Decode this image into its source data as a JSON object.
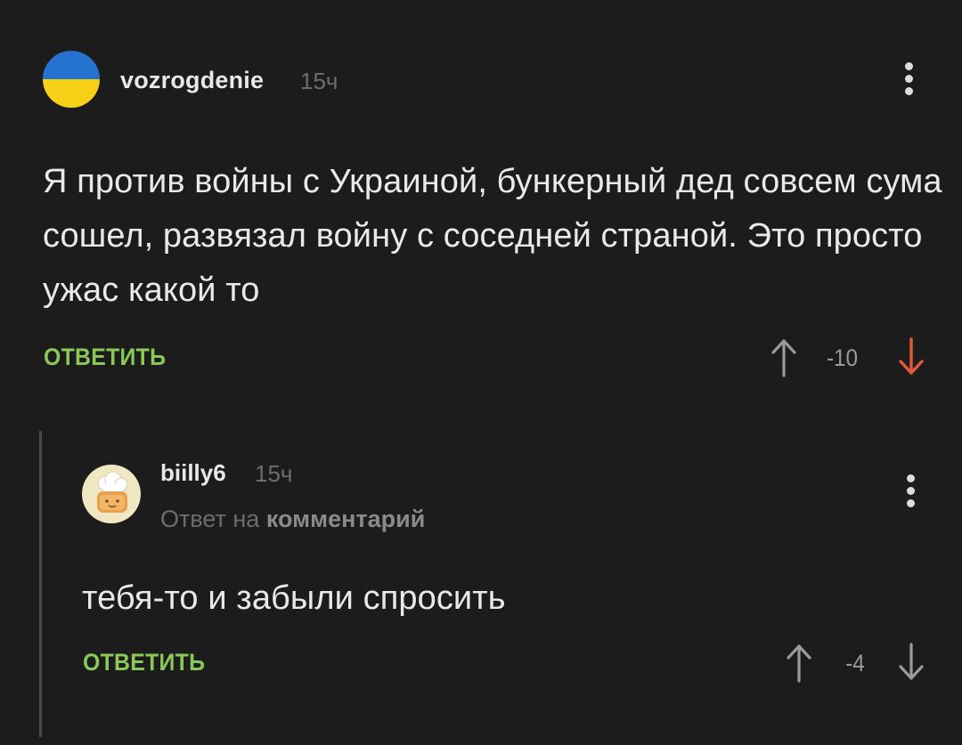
{
  "comment": {
    "username": "vozrogdenie",
    "time": "15ч",
    "text": "Я против войны с Украиной, бункерный дед совсем сума сошел, развязал войну с соседней страной. Это просто ужас какой то",
    "reply_label": "ОТВЕТИТЬ",
    "score": "-10",
    "avatar_icon": "ukraine-flag-icon",
    "down_arrow_color": "#e05a3a"
  },
  "reply": {
    "username": "biilly6",
    "time": "15ч",
    "meta_prefix": "Ответ на",
    "meta_link": "комментарий",
    "text": "тебя-то и забыли спросить",
    "reply_label": "ОТВЕТИТЬ",
    "score": "-4",
    "avatar_icon": "chef-avatar-icon"
  },
  "colors": {
    "background": "#1c1c1c",
    "accent_green": "#8ac858",
    "muted": "#6d6d6d"
  }
}
